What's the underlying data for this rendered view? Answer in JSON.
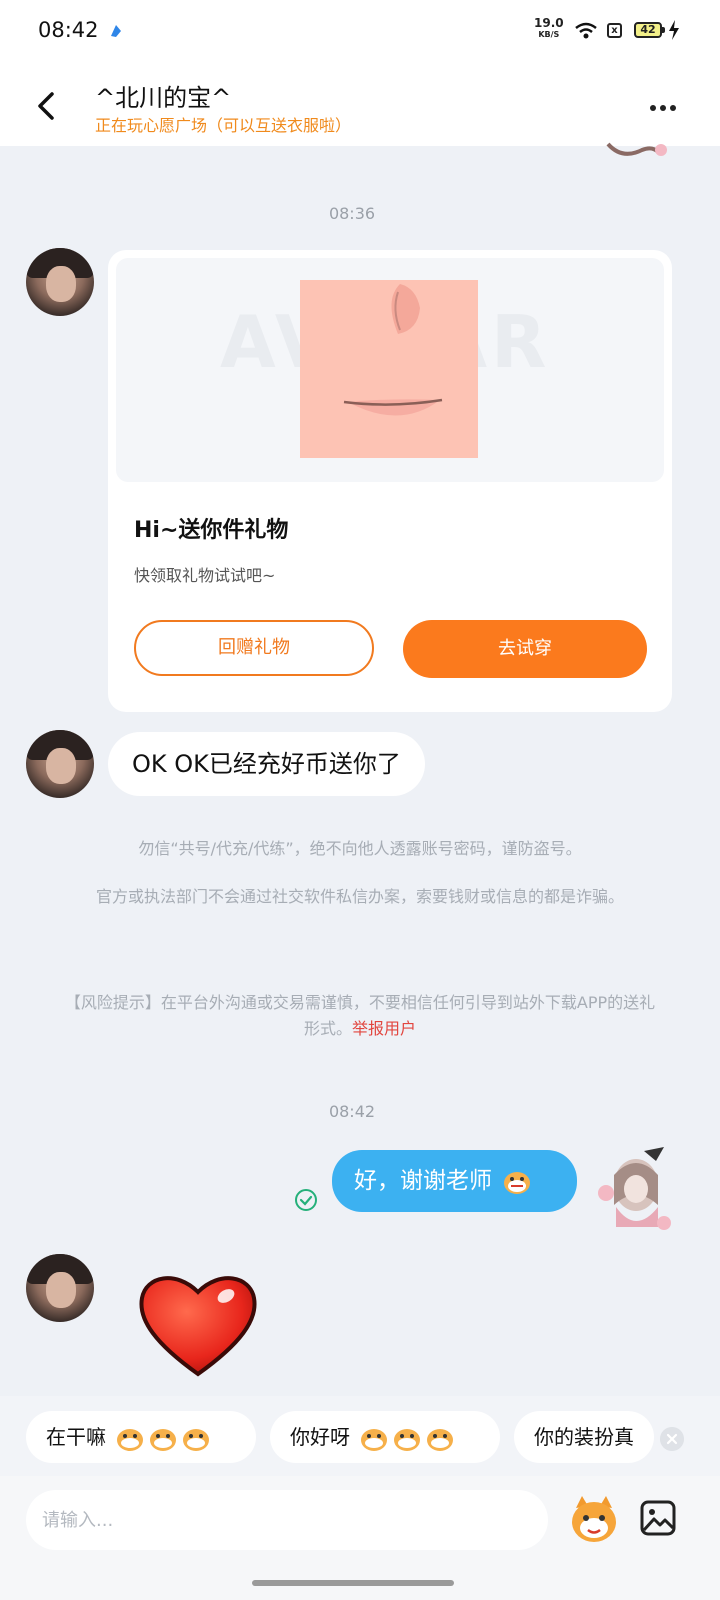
{
  "status_bar": {
    "time": "08:42",
    "net_speed_value": "19.0",
    "net_speed_unit": "KB/S",
    "battery": "42",
    "sim_label": "x"
  },
  "header": {
    "contact_name": "^北川的宝^",
    "contact_status": "正在玩心愿广场（可以互送衣服啦）"
  },
  "messages": {
    "timestamp_1": "08:36",
    "gift_card": {
      "watermark": "AVATAR",
      "title": "Hi~送你件礼物",
      "description": "快领取礼物试试吧~",
      "return_gift_label": "回赠礼物",
      "try_on_label": "去试穿"
    },
    "text_1": "OK OK已经充好币送你了",
    "notice_1": "勿信“共号/代充/代练”，绝不向他人透露账号密码，谨防盗号。",
    "notice_2": "官方或执法部门不会通过社交软件私信办案，索要钱财或信息的都是诈骗。",
    "notice_3": "【风险提示】在平台外沟通或交易需谨慎，不要相信任何引导到站外下载APP的送礼形式。",
    "report_link": "举报用户",
    "timestamp_2": "08:42",
    "my_text": "好，谢谢老师"
  },
  "quick_replies": [
    {
      "label": "在干嘛"
    },
    {
      "label": "你好呀"
    },
    {
      "label": "你的装扮真"
    }
  ],
  "input": {
    "placeholder": "请输入..."
  },
  "colors": {
    "accent_orange": "#fb7a1d",
    "status_orange": "#f08a1c",
    "my_bubble_blue": "#3cb1f1",
    "report_red": "#e2463f"
  },
  "icons": [
    "back-arrow-icon",
    "more-dots-icon",
    "check-circle-icon",
    "heart-sticker",
    "emoji-icon",
    "image-icon",
    "close-icon"
  ]
}
